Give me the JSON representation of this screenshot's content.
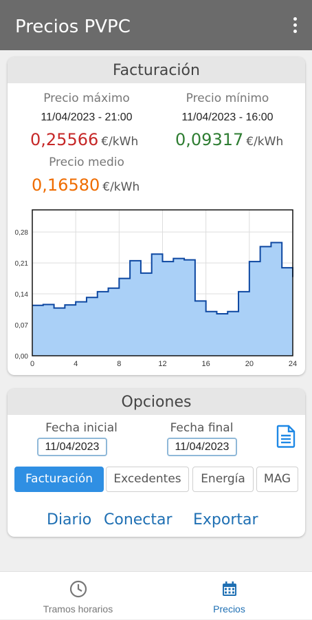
{
  "app": {
    "title": "Precios PVPC"
  },
  "facturacion": {
    "title": "Facturación",
    "max": {
      "label": "Precio máximo",
      "date": "11/04/2023 - 21:00",
      "value": "0,25566",
      "unit": "€/kWh"
    },
    "min": {
      "label": "Precio mínimo",
      "date": "11/04/2023 - 16:00",
      "value": "0,09317",
      "unit": "€/kWh"
    },
    "avg": {
      "label": "Precio medio",
      "value": "0,16580",
      "unit": "€/kWh"
    },
    "colors": {
      "max": "#c62828",
      "min": "#2e7d32",
      "avg": "#ef6c00",
      "line": "#0d47a1",
      "fill": "#aad0f7"
    }
  },
  "chart_data": {
    "type": "area",
    "x": [
      0,
      1,
      2,
      3,
      4,
      5,
      6,
      7,
      8,
      9,
      10,
      11,
      12,
      13,
      14,
      15,
      16,
      17,
      18,
      19,
      20,
      21,
      22,
      23
    ],
    "values": [
      0.114,
      0.116,
      0.108,
      0.115,
      0.122,
      0.132,
      0.145,
      0.153,
      0.175,
      0.215,
      0.187,
      0.23,
      0.213,
      0.22,
      0.217,
      0.124,
      0.1,
      0.095,
      0.1,
      0.145,
      0.213,
      0.247,
      0.256,
      0.199,
      0.178
    ],
    "xticks": [
      "0",
      "4",
      "8",
      "12",
      "16",
      "20",
      "24"
    ],
    "yticks": [
      "0,00",
      "0,07",
      "0,14",
      "0,21",
      "0,28"
    ],
    "xlim": [
      0,
      24
    ],
    "ylim": [
      0,
      0.33
    ],
    "step": true
  },
  "opciones": {
    "title": "Opciones",
    "fecha_inicial_label": "Fecha inicial",
    "fecha_inicial": "11/04/2023",
    "fecha_final_label": "Fecha final",
    "fecha_final": "11/04/2023",
    "tabs": [
      "Facturación",
      "Excedentes",
      "Energía",
      "MAG"
    ],
    "actions": {
      "diario": "Diario",
      "conectar": "Conectar",
      "exportar": "Exportar"
    }
  },
  "nav": {
    "tramos": "Tramos horarios",
    "precios": "Precios",
    "active_color": "#1e6fb3",
    "inactive_color": "#777777"
  }
}
